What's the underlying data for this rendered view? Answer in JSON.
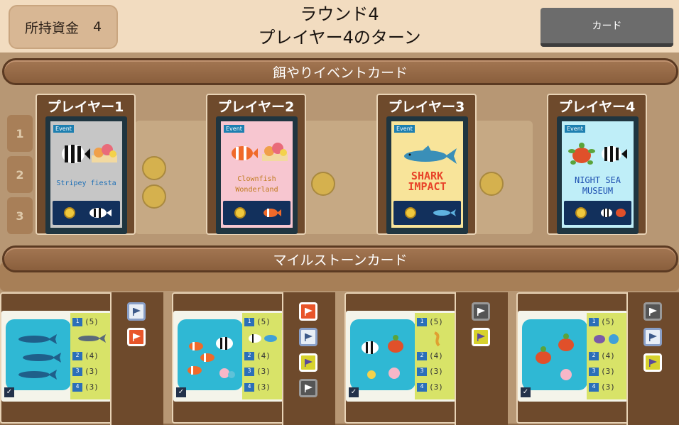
{
  "header": {
    "funds_label": "所持資金",
    "funds_value": "4",
    "round": "ラウンド4",
    "turn": "プレイヤー4のターン",
    "card_button": "カード"
  },
  "event_section": {
    "title": "餌やりイベントカード",
    "players": [
      {
        "name": "プレイヤー1",
        "tag": "Event",
        "card_title": "Stripey fiesta",
        "color": "#c6c6c6"
      },
      {
        "name": "プレイヤー2",
        "tag": "Event",
        "card_title": "Clownfish Wonderland",
        "color": "#f7c6d0"
      },
      {
        "name": "プレイヤー3",
        "tag": "Event",
        "card_title": "SHARK IMPACT",
        "color": "#f8e49a"
      },
      {
        "name": "プレイヤー4",
        "tag": "Event",
        "card_title": "NIGHT SEA MUSEUM",
        "color": "#bfeef8"
      }
    ]
  },
  "milestone_section": {
    "title": "マイルストーンカード",
    "cards": [
      {
        "rewards": [
          "1",
          "(5)",
          "2",
          "(4)",
          "3",
          "(3)",
          "4",
          "(3)"
        ]
      },
      {
        "rewards": [
          "1",
          "(5)",
          "2",
          "(4)",
          "3",
          "(3)",
          "4",
          "(3)"
        ]
      },
      {
        "rewards": [
          "1",
          "(5)",
          "2",
          "(4)",
          "3",
          "(3)",
          "4",
          "(3)"
        ]
      },
      {
        "rewards": [
          "1",
          "(5)",
          "2",
          "(4)",
          "3",
          "(3)",
          "4",
          "(3)"
        ]
      }
    ]
  },
  "backdrop_numbers": [
    "1",
    "2",
    "3"
  ],
  "icons": {
    "flag": "flag-icon",
    "check": "check-icon",
    "coin": "coin-icon"
  },
  "colors": {
    "banner": "#8a5f3d",
    "flag_white": "#e8eef6",
    "flag_orange": "#e8552a",
    "flag_yellow": "#d7d22d",
    "flag_dark": "#555555"
  }
}
